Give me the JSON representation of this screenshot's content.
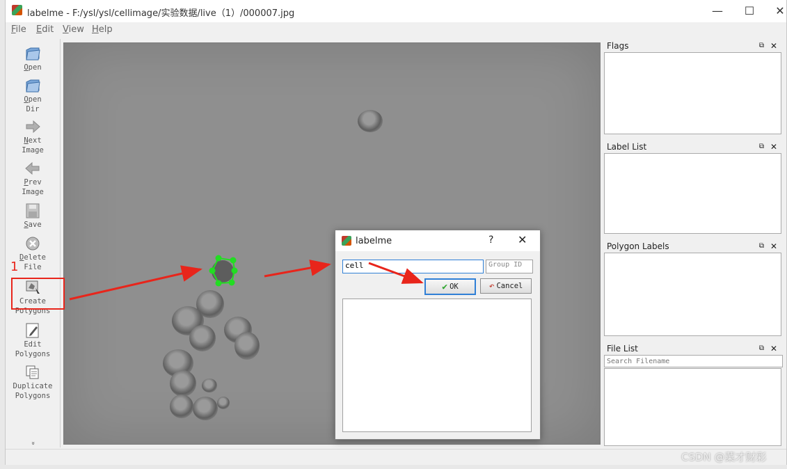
{
  "window": {
    "title": "labelme - F:/ysl/ysl/cellimage/实验数据/live（1）/000007.jpg",
    "controls": [
      "—",
      "☐",
      "✕"
    ]
  },
  "menu": [
    "File",
    "Edit",
    "View",
    "Help"
  ],
  "toolbar": {
    "open": "Open",
    "open_dir": "Open\nDir",
    "next_image": "Next\nImage",
    "prev_image": "Prev\nImage",
    "save": "Save",
    "delete_file": "Delete\nFile",
    "create_polygons": "Create\nPolygons",
    "edit_polygons": "Edit\nPolygons",
    "duplicate_polygons": "Duplicate\nPolygons",
    "more": "»"
  },
  "docks": {
    "flags": "Flags",
    "label_list": "Label List",
    "polygon_labels": "Polygon Labels",
    "file_list": "File List",
    "file_search_placeholder": "Search Filename"
  },
  "dialog": {
    "title": "labelme",
    "help": "?",
    "close": "✕",
    "label_value": "cell",
    "group_id_placeholder": "Group ID",
    "ok": "OK",
    "cancel": "Cancel"
  },
  "annotation": {
    "step_number": "1",
    "color": "#e8251b"
  },
  "watermark": "CSDN @菜才财彩",
  "colors": {
    "polygon_points": "#22dd22",
    "focus_border": "#2f7fd6"
  }
}
